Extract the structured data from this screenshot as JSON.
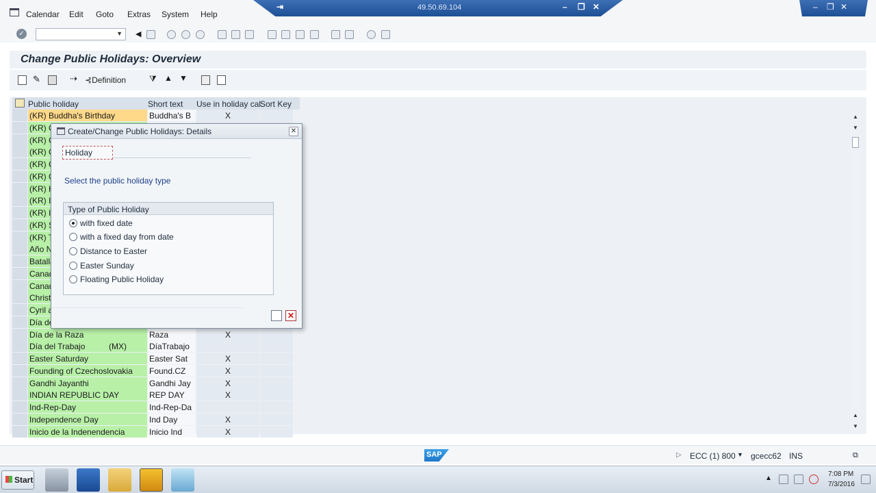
{
  "menubar": {
    "items": [
      "Calendar",
      "Edit",
      "Goto",
      "Extras",
      "System",
      "Help"
    ]
  },
  "remote": {
    "ip": "49.50.69.104",
    "pin_icon": "pin-icon"
  },
  "page": {
    "title": "Change Public Holidays: Overview"
  },
  "app_toolbar": {
    "definition_label": "Definition"
  },
  "table": {
    "headers": [
      "Public holiday",
      "Short text",
      "Use in holiday cal.",
      "Sort Key"
    ],
    "rows": [
      {
        "holiday": "(KR) Buddha's Birthday",
        "country": "",
        "short": "Buddha's B",
        "use": "X"
      },
      {
        "holiday": "(KR) C",
        "country": "",
        "short": "",
        "use": ""
      },
      {
        "holiday": "(KR) C",
        "country": "",
        "short": "",
        "use": ""
      },
      {
        "holiday": "(KR) C",
        "country": "",
        "short": "",
        "use": ""
      },
      {
        "holiday": "(KR) C",
        "country": "",
        "short": "",
        "use": ""
      },
      {
        "holiday": "(KR) C",
        "country": "",
        "short": "",
        "use": ""
      },
      {
        "holiday": "(KR) H",
        "country": "",
        "short": "",
        "use": ""
      },
      {
        "holiday": "(KR) I",
        "country": "",
        "short": "",
        "use": ""
      },
      {
        "holiday": "(KR) I",
        "country": "",
        "short": "",
        "use": ""
      },
      {
        "holiday": "(KR) S",
        "country": "",
        "short": "",
        "use": ""
      },
      {
        "holiday": "(KR) T",
        "country": "",
        "short": "",
        "use": ""
      },
      {
        "holiday": "Año N",
        "country": "",
        "short": "",
        "use": ""
      },
      {
        "holiday": "Batalla",
        "country": "",
        "short": "",
        "use": ""
      },
      {
        "holiday": "Canada",
        "country": "",
        "short": "",
        "use": ""
      },
      {
        "holiday": "Canadi",
        "country": "",
        "short": "",
        "use": ""
      },
      {
        "holiday": "Christm",
        "country": "",
        "short": "",
        "use": ""
      },
      {
        "holiday": "Cyril ar",
        "country": "",
        "short": "",
        "use": ""
      },
      {
        "holiday": "Día de",
        "country": "",
        "short": "",
        "use": ""
      },
      {
        "holiday": "Día de la Raza",
        "country": "",
        "short": "Raza",
        "use": "X"
      },
      {
        "holiday": "Día del Trabajo",
        "country": "(MX)",
        "short": "DíaTrabajo",
        "use": ""
      },
      {
        "holiday": "Easter Saturday",
        "country": "",
        "short": "Easter Sat",
        "use": "X"
      },
      {
        "holiday": "Founding of Czechoslovakia",
        "country": "",
        "short": "Found.CZ",
        "use": "X"
      },
      {
        "holiday": "Gandhi Jayanthi",
        "country": "",
        "short": "Gandhi Jay",
        "use": "X"
      },
      {
        "holiday": "INDIAN REPUBLIC DAY",
        "country": "",
        "short": "REP DAY",
        "use": "X"
      },
      {
        "holiday": "Ind-Rep-Day",
        "country": "",
        "short": "Ind-Rep-Da",
        "use": ""
      },
      {
        "holiday": "Independence Day",
        "country": "",
        "short": "Ind Day",
        "use": "X"
      },
      {
        "holiday": "Inicio de la Indenendencia",
        "country": "",
        "short": "Inicio Ind",
        "use": "X"
      }
    ]
  },
  "dialog": {
    "title": "Create/Change Public Holidays: Details",
    "tab": "Holiday",
    "prompt": "Select the public holiday type",
    "group_title": "Type of Public Holiday",
    "options": [
      {
        "label": "with fixed date",
        "checked": true
      },
      {
        "label": "with a fixed day from date",
        "checked": false
      },
      {
        "label": "Distance to Easter",
        "checked": false
      },
      {
        "label": "Easter Sunday",
        "checked": false
      },
      {
        "label": "Floating Public Holiday",
        "checked": false
      }
    ]
  },
  "statusbar": {
    "logo": "SAP",
    "system": "ECC (1) 800",
    "server": "gcecc62",
    "mode": "INS"
  },
  "taskbar": {
    "start_label": "Start",
    "time": "7:08 PM",
    "date": "7/3/2016"
  }
}
